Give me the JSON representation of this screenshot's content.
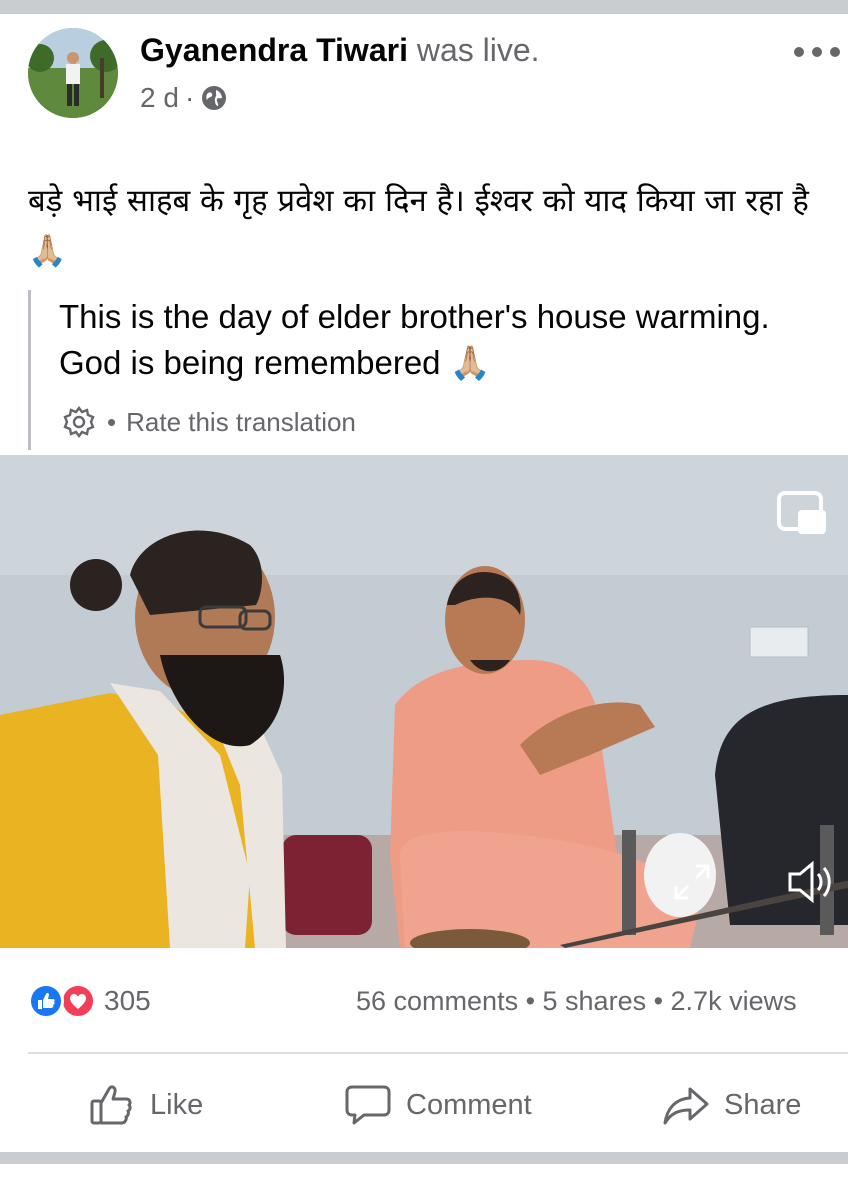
{
  "post": {
    "author": "Gyanendra Tiwari",
    "status": "was live.",
    "time": "2 d",
    "separator": "·",
    "privacy_icon": "globe-icon",
    "more_icon": "more-horizontal-icon",
    "text_hindi": "बड़े भाई साहब के गृह प्रवेश का दिन है। ईश्वर को याद किया जा रहा है 🙏🏼",
    "translation": "This is the day of elder brother's house warming. God is being remembered 🙏🏼",
    "rate_translation": "Rate this translation",
    "rate_separator": "•"
  },
  "video": {
    "pip_icon": "picture-in-picture-icon",
    "expand_icon": "expand-icon",
    "volume_icon": "volume-icon"
  },
  "stats": {
    "reaction_count": "305",
    "comments_shares_views": "56 comments • 5 shares • 2.7k views"
  },
  "actions": {
    "like": "Like",
    "comment": "Comment",
    "share": "Share"
  },
  "colors": {
    "accent": "#1877f2",
    "love": "#f33e58",
    "secondary_text": "#65676b",
    "background": "#c9ccd1"
  }
}
